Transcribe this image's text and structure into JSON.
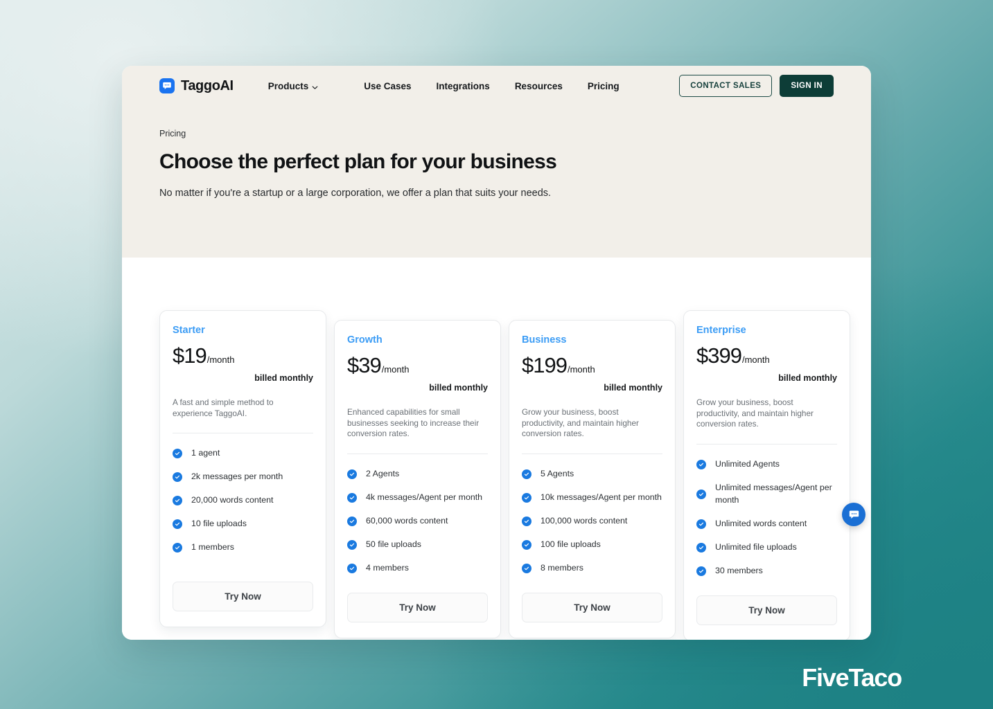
{
  "header": {
    "brand_name": "TaggoAI",
    "brand_icon": "chat-bubble-logo-icon",
    "nav": [
      {
        "label": "Products",
        "has_caret": true
      },
      {
        "label": "Use Cases",
        "has_caret": false
      },
      {
        "label": "Integrations",
        "has_caret": false
      },
      {
        "label": "Resources",
        "has_caret": false
      },
      {
        "label": "Pricing",
        "has_caret": false
      }
    ],
    "contact_sales_label": "CONTACT SALES",
    "sign_in_label": "SIGN IN"
  },
  "hero": {
    "eyebrow": "Pricing",
    "title": "Choose the perfect plan for your business",
    "subtitle": "No matter if you're a startup or a large corporation, we offer a plan that suits your needs."
  },
  "pricing": {
    "billed_label": "billed monthly",
    "cta_label": "Try Now",
    "plans": [
      {
        "name": "Starter",
        "price": "$19",
        "period": "/month",
        "description": "A fast and simple method to experience TaggoAI.",
        "features": [
          "1 agent",
          "2k messages per month",
          "20,000 words content",
          "10 file uploads",
          "1 members"
        ]
      },
      {
        "name": "Growth",
        "price": "$39",
        "period": "/month",
        "description": "Enhanced capabilities for small businesses seeking to increase their conversion rates.",
        "features": [
          "2 Agents",
          "4k messages/Agent per month",
          "60,000 words content",
          "50 file uploads",
          "4 members"
        ]
      },
      {
        "name": "Business",
        "price": "$199",
        "period": "/month",
        "description": "Grow your business, boost productivity, and maintain higher conversion rates.",
        "features": [
          "5 Agents",
          "10k messages/Agent per month",
          "100,000 words content",
          "100 file uploads",
          "8 members"
        ]
      },
      {
        "name": "Enterprise",
        "price": "$399",
        "period": "/month",
        "description": "Grow your business, boost productivity, and maintain higher conversion rates.",
        "features": [
          "Unlimited Agents",
          "Unlimited messages/Agent per month",
          "Unlimited words content",
          "Unlimited file uploads",
          "30 members"
        ]
      }
    ]
  },
  "chat_widget": {
    "icon": "chat-bubble-icon"
  },
  "watermark": {
    "text": "FiveTaco"
  },
  "colors": {
    "accent_blue": "#3b9cf5",
    "check_blue": "#1a7ae0",
    "brand_blue": "#1a73f0",
    "dark_green": "#0d3d37",
    "hero_beige": "#f2efe9",
    "page_teal": "#1d8183"
  }
}
